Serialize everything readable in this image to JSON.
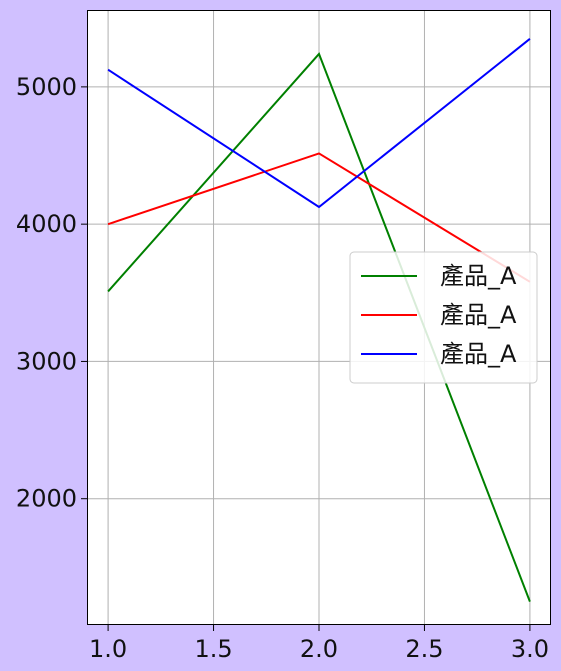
{
  "chart_data": {
    "type": "line",
    "title": "",
    "xlabel": "",
    "ylabel": "",
    "x": [
      1.0,
      2.0,
      3.0
    ],
    "series": [
      {
        "name": "產品_A",
        "color": "#008000",
        "values": [
          3510,
          5240,
          1250
        ]
      },
      {
        "name": "產品_A",
        "color": "#ff0000",
        "values": [
          4000,
          4515,
          3580
        ]
      },
      {
        "name": "產品_A",
        "color": "#0000ff",
        "values": [
          5125,
          4125,
          5350
        ]
      }
    ],
    "xlim": [
      0.9,
      3.1
    ],
    "ylim": [
      1080,
      5560
    ],
    "x_ticks": [
      1.0,
      1.5,
      2.0,
      2.5,
      3.0
    ],
    "x_tick_labels": [
      "1.0",
      "1.5",
      "2.0",
      "2.5",
      "3.0"
    ],
    "y_ticks": [
      2000,
      3000,
      4000,
      5000
    ],
    "y_tick_labels": [
      "2000",
      "3000",
      "4000",
      "5000"
    ],
    "grid": true,
    "legend_position": "center-right",
    "background_color": "#d0c0ff",
    "plot_background_color": "#ffffff",
    "grid_color": "#b0b0b0"
  }
}
